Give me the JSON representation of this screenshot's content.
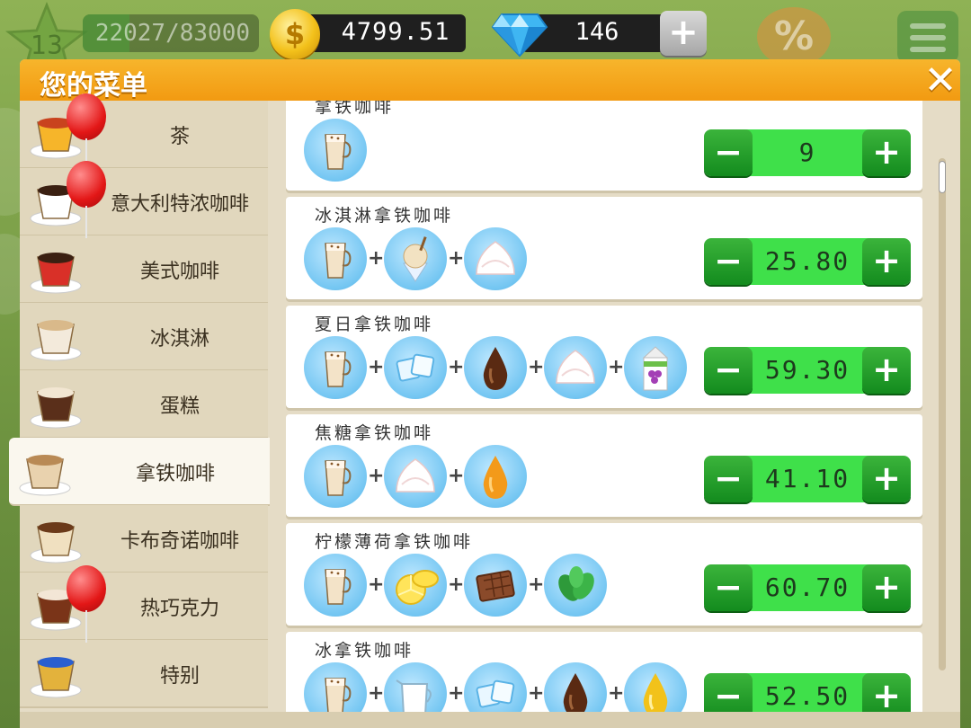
{
  "hud": {
    "level": "13",
    "xp_text": "22027/83000",
    "xp_progress": 0.265,
    "coins": "4799.51",
    "coin_symbol": "$",
    "gems": "146",
    "gem_plus": "+",
    "discount_symbol": "%"
  },
  "panel": {
    "title": "您的菜单",
    "close": "✕"
  },
  "sidebar": {
    "items": [
      {
        "label": "茶",
        "icon": "tea-cup-icon",
        "balloon": true
      },
      {
        "label": "意大利特浓咖啡",
        "icon": "espresso-cup-icon",
        "balloon": true
      },
      {
        "label": "美式咖啡",
        "icon": "americano-cup-icon",
        "balloon": false
      },
      {
        "label": "冰淇淋",
        "icon": "ice-cream-icon",
        "balloon": false
      },
      {
        "label": "蛋糕",
        "icon": "cake-slice-icon",
        "balloon": false
      },
      {
        "label": "拿铁咖啡",
        "icon": "latte-glass-icon",
        "balloon": false,
        "selected": true
      },
      {
        "label": "卡布奇诺咖啡",
        "icon": "cappuccino-glass-icon",
        "balloon": false
      },
      {
        "label": "热巧克力",
        "icon": "hot-chocolate-icon",
        "balloon": true
      },
      {
        "label": "特别",
        "icon": "special-basket-icon",
        "balloon": false
      }
    ]
  },
  "recipes": [
    {
      "name": "拿铁咖啡",
      "ingredients": [
        "latte-icon"
      ],
      "value": "9"
    },
    {
      "name": "冰淇淋拿铁咖啡",
      "ingredients": [
        "latte-icon",
        "ice-cream-icon",
        "whipped-cream-icon"
      ],
      "value": "25.80"
    },
    {
      "name": "夏日拿铁咖啡",
      "ingredients": [
        "latte-icon",
        "ice-cubes-icon",
        "chocolate-syrup-icon",
        "whipped-cream-icon",
        "grape-juice-icon"
      ],
      "value": "59.30"
    },
    {
      "name": "焦糖拿铁咖啡",
      "ingredients": [
        "latte-icon",
        "whipped-cream-icon",
        "caramel-drop-icon"
      ],
      "value": "41.10"
    },
    {
      "name": "柠檬薄荷拿铁咖啡",
      "ingredients": [
        "latte-icon",
        "lemon-icon",
        "chocolate-bar-icon",
        "mint-leaves-icon"
      ],
      "value": "60.70"
    },
    {
      "name": "冰拿铁咖啡",
      "ingredients": [
        "latte-icon",
        "milk-jug-icon",
        "ice-cubes-icon",
        "chocolate-syrup-icon",
        "honey-drop-icon"
      ],
      "value": "52.50"
    }
  ],
  "stepper": {
    "minus": "−",
    "plus": "+"
  },
  "ingredient_joiner": "+",
  "colors": {
    "header": "#f29a11",
    "stepper_green": "#3fe04a",
    "stepper_button": "#138b1e",
    "ingredient_bg": "#74c6f2"
  }
}
